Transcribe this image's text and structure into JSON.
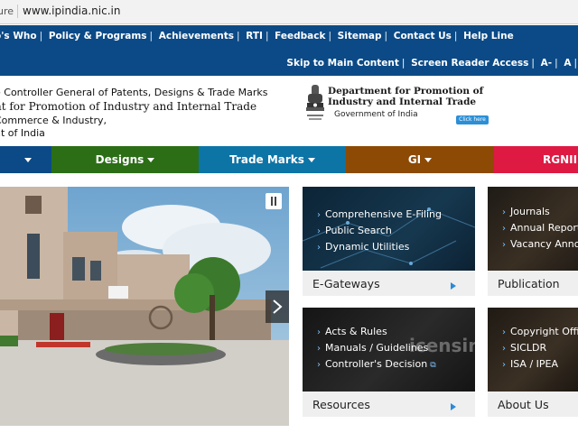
{
  "addressbar": {
    "secure_text": "ure",
    "url": "www.ipindia.nic.in"
  },
  "topnav": {
    "links": [
      "o's Who",
      "Policy & Programs",
      "Achievements",
      "RTI",
      "Feedback",
      "Sitemap",
      "Contact Us",
      "Help Line"
    ],
    "access": [
      "Skip to Main Content",
      "Screen Reader Access",
      "A-",
      "A"
    ]
  },
  "header": {
    "line1": "e Controller General of Patents, Designs & Trade Marks",
    "line2": "nt for Promotion of Industry and Internal Trade",
    "line3": "Commerce & Industry,",
    "line4": "nt of India",
    "dept_line1": "Department for Promotion of",
    "dept_line2": "Industry and Internal Trade",
    "government": "Government of India",
    "click_here": "Click here"
  },
  "categories": [
    {
      "label": "",
      "color": "#0b4a86"
    },
    {
      "label": "Designs",
      "color": "#2b6e16"
    },
    {
      "label": "Trade Marks",
      "color": "#0d74a6"
    },
    {
      "label": "GI",
      "color": "#8d4a04"
    },
    {
      "label": "RGNIIPI",
      "color": "#de1a43"
    }
  ],
  "tiles": {
    "egateways": {
      "caption": "E-Gateways",
      "items": [
        "Comprehensive E-Filing",
        "Public Search",
        "Dynamic Utilities"
      ]
    },
    "publication": {
      "caption": "Publication",
      "items": [
        "Journals",
        "Annual Reports",
        "Vacancy Annou"
      ]
    },
    "resources": {
      "caption": "Resources",
      "items": [
        "Acts & Rules",
        "Manuals / Guidelines",
        "Controller's Decision"
      ],
      "bg_text": "icensing"
    },
    "about": {
      "caption": "About Us",
      "items": [
        "Copyright Office",
        "SICLDR",
        "ISA / IPEA"
      ]
    }
  },
  "colors": {
    "nav_blue": "#0b4a86",
    "tile_bg": "#efefef",
    "link_blue": "#2a8ad8"
  }
}
